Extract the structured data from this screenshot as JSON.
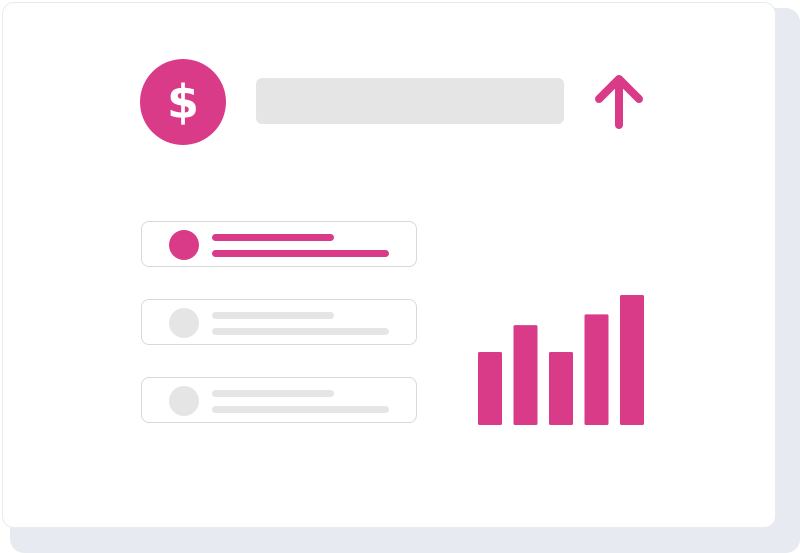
{
  "badge": {
    "symbol": "$"
  },
  "colors": {
    "accent": "#d93b89",
    "placeholder": "#e5e5e5",
    "backdrop": "#e8eaf1"
  },
  "icons": {
    "trend": "arrow-up-icon",
    "badge": "dollar-icon"
  },
  "list": {
    "items": [
      {
        "state": "active"
      },
      {
        "state": "inactive"
      },
      {
        "state": "inactive"
      }
    ]
  },
  "chart_data": {
    "type": "bar",
    "values": [
      68,
      93,
      68,
      103,
      121
    ],
    "ylim": [
      0,
      121
    ],
    "grid": false
  }
}
